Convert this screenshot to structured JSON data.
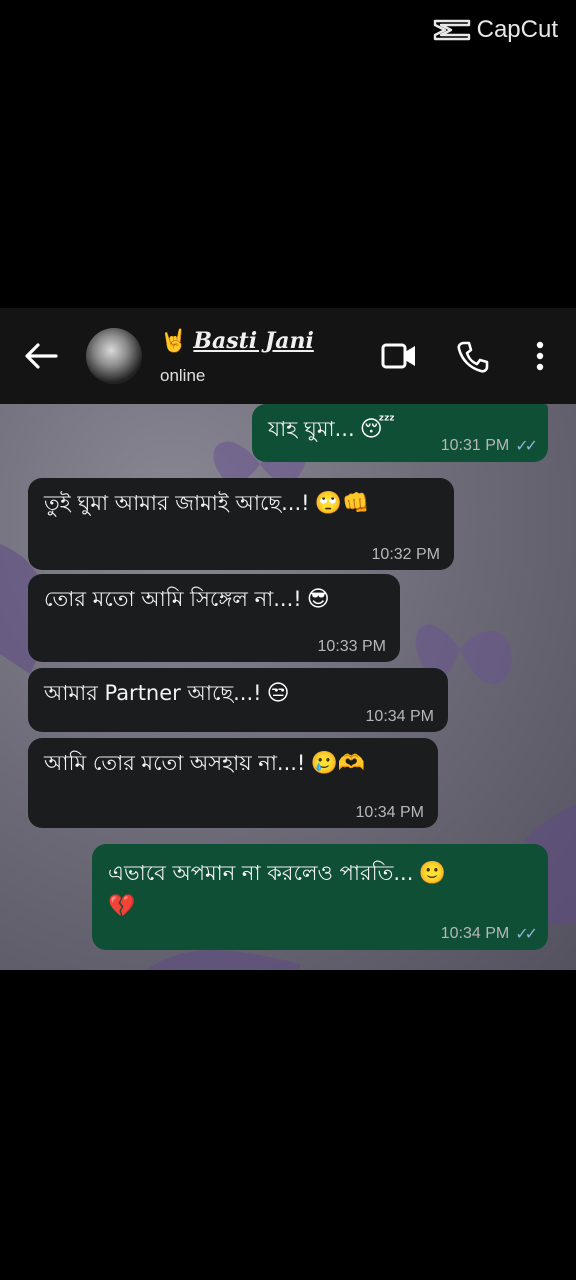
{
  "watermark": {
    "text": "CapCut"
  },
  "contact": {
    "name": "Basti Jani",
    "hand_emoji": "🤘",
    "status": "online"
  },
  "messages": [
    {
      "side": "out",
      "text": "যাহ ঘুমা...",
      "emoji": "😴",
      "time": "10:31 PM",
      "ticks": "✓✓"
    },
    {
      "side": "in",
      "text": "তুই ঘুমা আমার জামাই আছে...!",
      "emoji": "🙄👊",
      "time": "10:32 PM"
    },
    {
      "side": "in",
      "text": "তোর মতো আমি সিঙ্গেল না...!",
      "emoji": "😎",
      "time": "10:33 PM"
    },
    {
      "side": "in",
      "text": "আমার Partner আছে...!",
      "emoji": "😒",
      "time": "10:34 PM"
    },
    {
      "side": "in",
      "text": "আমি তোর মতো অসহায় না...!",
      "emoji": "🥲🫶",
      "time": "10:34 PM"
    },
    {
      "side": "out",
      "text": "এভাবে অপমান না করলেও পারতি...",
      "emoji": "🙂",
      "emoji2": "💔",
      "time": "10:34 PM",
      "ticks": "✓✓"
    }
  ],
  "icons": [
    "back-arrow-icon",
    "video-call-icon",
    "phone-icon",
    "more-options-icon",
    "capcut-logo-icon"
  ],
  "colors": {
    "incoming_bubble": "#1a1c1e",
    "outgoing_bubble": "#0f4f35",
    "header": "#141414"
  }
}
